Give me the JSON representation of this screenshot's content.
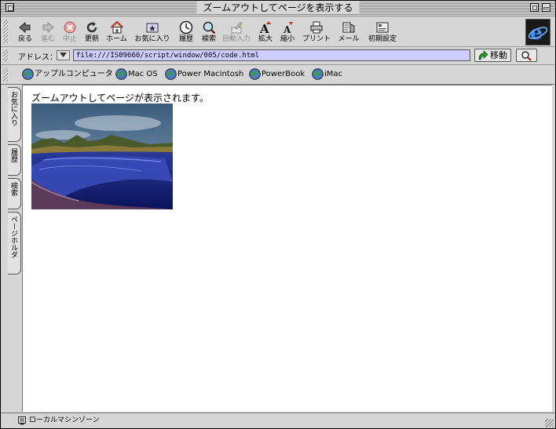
{
  "window": {
    "title": "ズームアウトしてページを表示する"
  },
  "toolbar": {
    "buttons": [
      {
        "label": "戻る",
        "icon": "back-arrow-icon"
      },
      {
        "label": "進む",
        "icon": "forward-arrow-icon"
      },
      {
        "label": "中止",
        "icon": "stop-icon"
      },
      {
        "label": "更新",
        "icon": "refresh-icon"
      },
      {
        "label": "ホーム",
        "icon": "home-icon"
      },
      {
        "label": "お気に入り",
        "icon": "favorites-icon"
      },
      {
        "label": "履歴",
        "icon": "history-icon"
      },
      {
        "label": "検索",
        "icon": "search-icon"
      },
      {
        "label": "自動入力",
        "icon": "autofill-icon"
      },
      {
        "label": "拡大",
        "icon": "text-larger-icon"
      },
      {
        "label": "縮小",
        "icon": "text-smaller-icon"
      },
      {
        "label": "プリント",
        "icon": "print-icon"
      },
      {
        "label": "メール",
        "icon": "mail-icon"
      },
      {
        "label": "初期設定",
        "icon": "preferences-icon"
      }
    ]
  },
  "address": {
    "label": "アドレス：",
    "url": "file:///IS09660/script/window/005/code.html",
    "go_label": "移動"
  },
  "favorites": {
    "items": [
      {
        "label": "アップルコンピュータ"
      },
      {
        "label": "Mac OS"
      },
      {
        "label": "Power Macintosh"
      },
      {
        "label": "PowerBook"
      },
      {
        "label": "iMac"
      }
    ]
  },
  "sidetabs": [
    {
      "label": "お気に入り"
    },
    {
      "label": "履歴"
    },
    {
      "label": "検索"
    },
    {
      "label": "ページホルダ"
    }
  ],
  "content": {
    "text": "ズームアウトしてページが表示されます。"
  },
  "status": {
    "text": "ローカルマシンゾーン"
  },
  "colors": {
    "address_bg": "#ccccff",
    "chrome": "#d6d6d6"
  }
}
